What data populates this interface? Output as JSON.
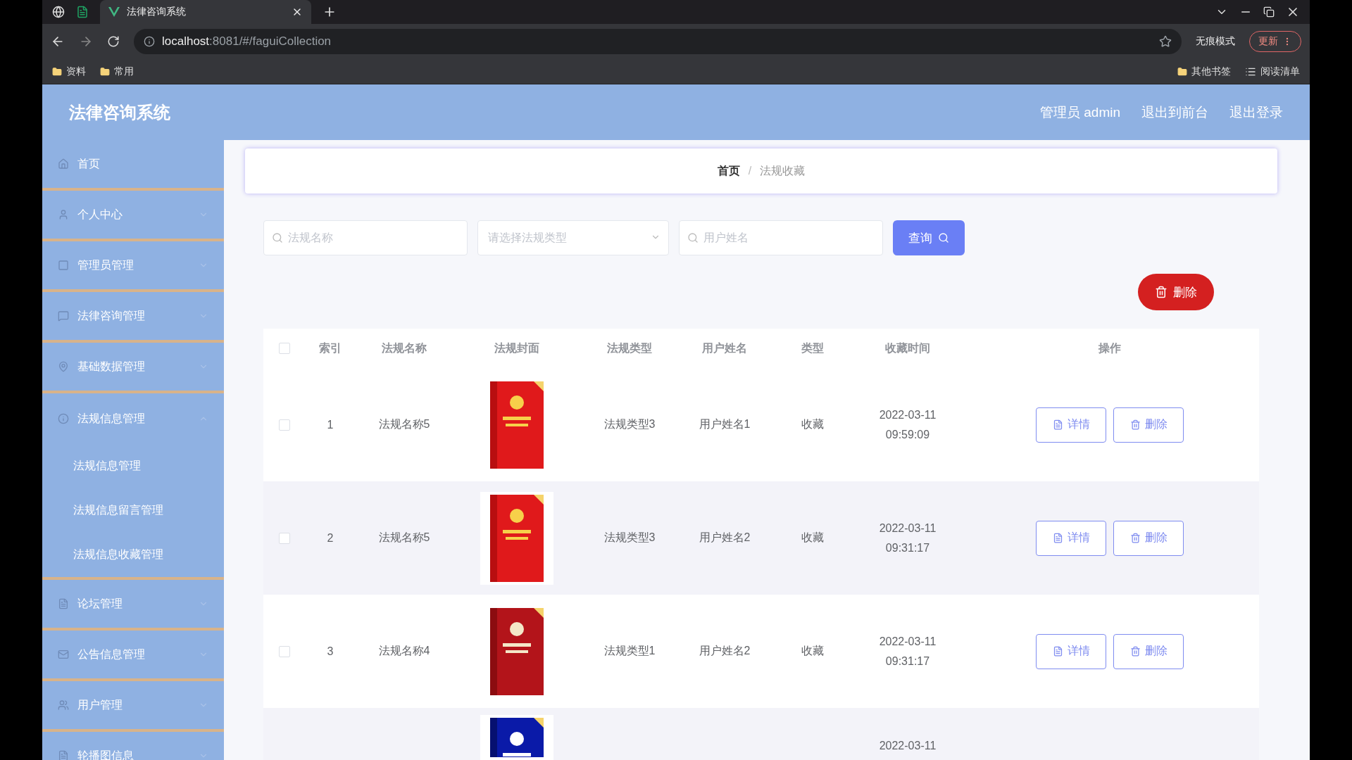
{
  "browser": {
    "tabs": [
      {
        "title": "法律咨询系统",
        "selected": true
      }
    ],
    "url_host": "localhost",
    "url_path": ":8081/#/faguiCollection",
    "bookmarks": [
      "资料",
      "常用"
    ],
    "profile": "无痕模式",
    "update": "更新",
    "other_bookmarks": "其他书签",
    "reading_list": "阅读清单"
  },
  "header": {
    "title": "法律咨询系统",
    "links": [
      "管理员 admin",
      "退出到前台",
      "退出登录"
    ]
  },
  "sidebar": {
    "items": [
      {
        "label": "首页",
        "expanded": false
      },
      {
        "label": "个人中心",
        "expanded": false
      },
      {
        "label": "管理员管理",
        "expanded": false
      },
      {
        "label": "法律咨询管理",
        "expanded": false
      },
      {
        "label": "基础数据管理",
        "expanded": false
      },
      {
        "label": "法规信息管理",
        "expanded": true,
        "children": [
          {
            "label": "法规信息管理"
          },
          {
            "label": "法规信息留言管理"
          },
          {
            "label": "法规信息收藏管理"
          }
        ]
      },
      {
        "label": "论坛管理",
        "expanded": false
      },
      {
        "label": "公告信息管理",
        "expanded": false
      },
      {
        "label": "用户管理",
        "expanded": false
      },
      {
        "label": "轮播图信息",
        "expanded": false
      }
    ]
  },
  "breadcrumb": {
    "home": "首页",
    "separator": "/",
    "current": "法规收藏"
  },
  "filters": {
    "name_placeholder": "法规名称",
    "type_placeholder": "请选择法规类型",
    "user_placeholder": "用户姓名",
    "search_button": "查询"
  },
  "delete_button": "删除",
  "table": {
    "all_checked": false,
    "columns": [
      "索引",
      "法规名称",
      "法规封面",
      "法规类型",
      "用户姓名",
      "类型",
      "收藏时间",
      "操作"
    ],
    "rows": [
      {
        "index": "1",
        "name": "法规名称5",
        "law_type": "法规类型3",
        "user": "用户姓名1",
        "kind": "收藏",
        "date": "2022-03-11",
        "time": "09:59:09",
        "checked": false,
        "actions": [
          "详情",
          "删除"
        ]
      },
      {
        "index": "2",
        "name": "法规名称5",
        "law_type": "法规类型3",
        "user": "用户姓名2",
        "kind": "收藏",
        "date": "2022-03-11",
        "time": "09:31:17",
        "checked": false,
        "actions": [
          "详情",
          "删除"
        ]
      },
      {
        "index": "3",
        "name": "法规名称4",
        "law_type": "法规类型1",
        "user": "用户姓名2",
        "kind": "收藏",
        "date": "2022-03-11",
        "time": "09:31:17",
        "checked": false,
        "actions": [
          "详情",
          "删除"
        ]
      },
      {
        "date": "2022-03-11"
      }
    ]
  }
}
